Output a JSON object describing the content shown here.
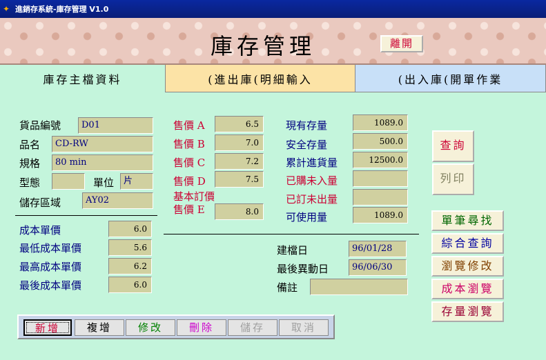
{
  "window": {
    "title": "進銷存系統-庫存管理 V1.0"
  },
  "header": {
    "title": "庫存管理",
    "exit_label": "離開"
  },
  "tabs": [
    {
      "label": "庫存主檔資料"
    },
    {
      "label": "(進出庫(明細輸入"
    },
    {
      "label": "(出入庫(開單作業"
    }
  ],
  "item": {
    "code_label": "貨品編號",
    "code": "D01",
    "name_label": "品名",
    "name": "CD-RW",
    "spec_label": "規格",
    "spec": "80 min",
    "type_label": "型態",
    "type": "",
    "unit_label": "單位",
    "unit": "片",
    "area_label": "儲存區域",
    "area": "AY02"
  },
  "cost": {
    "unit_cost_label": "成本單價",
    "unit_cost": "6.0",
    "min_cost_label": "最低成本單價",
    "min_cost": "5.6",
    "max_cost_label": "最高成本單價",
    "max_cost": "6.2",
    "last_cost_label": "最後成本單價",
    "last_cost": "6.0"
  },
  "prices": {
    "a_label": "售價 A",
    "a": "6.5",
    "b_label": "售價 B",
    "b": "7.0",
    "c_label": "售價 C",
    "c": "7.2",
    "d_label": "售價 D",
    "d": "7.5",
    "e_label1": "基本訂價",
    "e_label2": "售價 E",
    "e": "8.0"
  },
  "stock": {
    "current_label": "現有存量",
    "current": "1089.0",
    "safety_label": "安全存量",
    "safety": "500.0",
    "total_in_label": "累計進貨量",
    "total_in": "12500.0",
    "bought_label": "已購未入量",
    "bought": "",
    "ordered_label": "已訂未出量",
    "ordered": "",
    "available_label": "可使用量",
    "available": "1089.0"
  },
  "meta": {
    "created_label": "建檔日",
    "created": "96/01/28",
    "modified_label": "最後異動日",
    "modified": "96/06/30",
    "note_label": "備註",
    "note": ""
  },
  "side": {
    "query": "查詢",
    "print": "列印",
    "single_find": "單筆尋找",
    "combined_query": "綜合查詢",
    "browse_edit": "瀏覽修改",
    "cost_browse": "成本瀏覽",
    "stock_browse": "存量瀏覽"
  },
  "toolbar": {
    "add": "新增",
    "duplicate": "複增",
    "edit": "修改",
    "delete": "刪除",
    "save": "儲存",
    "cancel": "取消"
  },
  "colors": {
    "form_bg": "#c4f5dc",
    "field_bg": "#d0d0a0",
    "accent_red": "#cc0033",
    "title_bar": "#0a28a0"
  }
}
